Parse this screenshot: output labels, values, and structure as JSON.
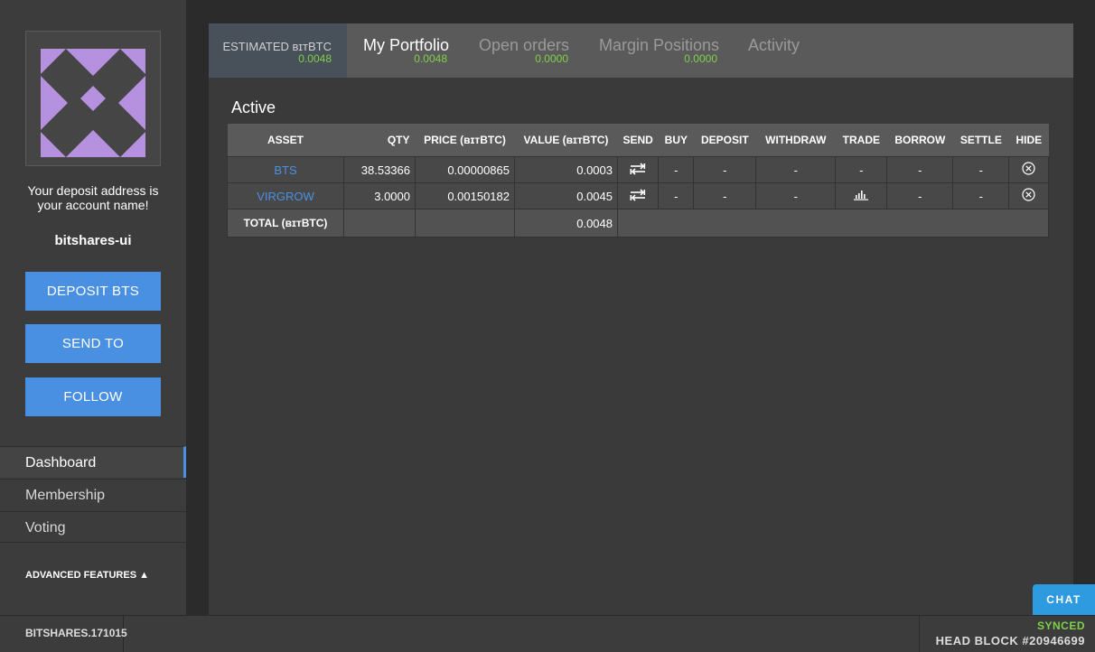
{
  "sidebar": {
    "deposit_note_line1": "Your deposit address is",
    "deposit_note_line2": "your account name!",
    "account_name": "bitshares-ui",
    "buttons": {
      "deposit": "DEPOSIT BTS",
      "send": "SEND TO",
      "follow": "FOLLOW"
    },
    "nav": [
      {
        "label": "Dashboard",
        "active": true
      },
      {
        "label": "Membership",
        "active": false
      },
      {
        "label": "Voting",
        "active": false
      }
    ],
    "advanced_features": "ADVANCED FEATURES ▲"
  },
  "header": {
    "estimated_label": "ESTIMATED ʙɪᴛBTC",
    "estimated_value": "0.0048",
    "tabs": [
      {
        "label": "My Portfolio",
        "value": "0.0048",
        "active": true
      },
      {
        "label": "Open orders",
        "value": "0.0000",
        "active": false
      },
      {
        "label": "Margin Positions",
        "value": "0.0000",
        "active": false
      },
      {
        "label": "Activity",
        "value": "",
        "active": false
      }
    ]
  },
  "portfolio": {
    "section_title": "Active",
    "columns": [
      "ASSET",
      "QTY",
      "PRICE (ʙɪᴛBTC)",
      "VALUE (ʙɪᴛBTC)",
      "SEND",
      "BUY",
      "DEPOSIT",
      "WITHDRAW",
      "TRADE",
      "BORROW",
      "SETTLE",
      "HIDE"
    ],
    "rows": [
      {
        "asset": "BTS",
        "qty": "38.53366",
        "price": "0.00000865",
        "value": "0.0003",
        "send_icon": "transfer-icon",
        "buy": "-",
        "deposit": "-",
        "withdraw": "-",
        "trade": "-",
        "borrow": "-",
        "settle": "-",
        "hide_icon": "hide-icon"
      },
      {
        "asset": "VIRGROW",
        "qty": "3.0000",
        "price": "0.00150182",
        "value": "0.0045",
        "send_icon": "transfer-icon",
        "buy": "-",
        "deposit": "-",
        "withdraw": "-",
        "trade_icon": "trade-chart-icon",
        "borrow": "-",
        "settle": "-",
        "hide_icon": "hide-icon"
      }
    ],
    "total_label": "TOTAL (ʙɪᴛBTC)",
    "total_value": "0.0048"
  },
  "footer": {
    "version": "BITSHARES.171015",
    "sync_status": "SYNCED",
    "head_block": "HEAD BLOCK #20946699",
    "chat_label": "CHAT"
  },
  "colors": {
    "accent": "#4a90e2",
    "positive": "#7fd14a",
    "avatar": "#b591e0"
  }
}
